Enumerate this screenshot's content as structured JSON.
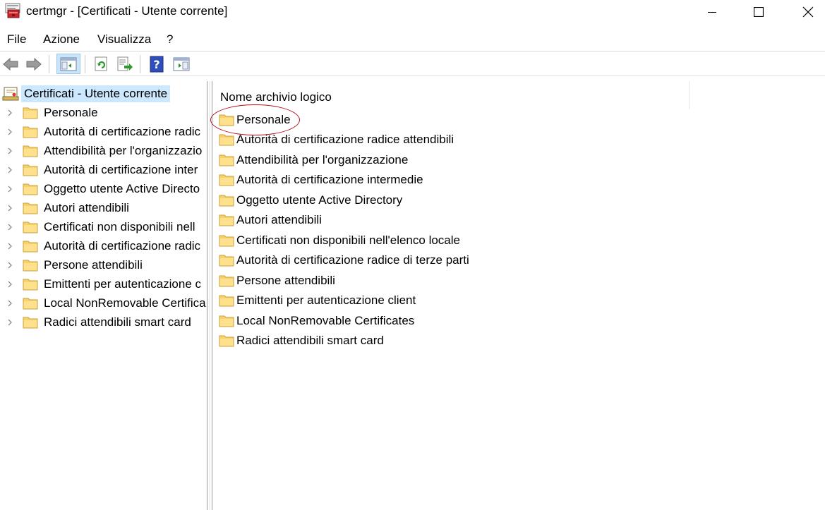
{
  "window": {
    "title": "certmgr - [Certificati - Utente corrente]"
  },
  "menu": {
    "items": [
      "File",
      "Azione",
      "Visualizza",
      "?"
    ]
  },
  "toolbar": {
    "buttons": [
      "back-arrow-icon",
      "forward-arrow-icon",
      "show-hide-console-tree-icon",
      "refresh-icon",
      "export-list-icon",
      "help-icon",
      "show-hide-action-pane-icon"
    ]
  },
  "tree": {
    "root_label": "Certificati - Utente corrente",
    "items": [
      "Personale",
      "Autorità di certificazione radic",
      "Attendibilità per l'organizzazio",
      "Autorità di certificazione inter",
      "Oggetto utente Active Directo",
      "Autori attendibili",
      "Certificati non disponibili nell",
      "Autorità di certificazione radic",
      "Persone attendibili",
      "Emittenti per autenticazione c",
      "Local NonRemovable Certifica",
      "Radici attendibili smart card"
    ]
  },
  "list": {
    "column_header": "Nome archivio logico",
    "items": [
      "Personale",
      "Autorità di certificazione radice attendibili",
      "Attendibilità per l'organizzazione",
      "Autorità di certificazione intermedie",
      "Oggetto utente Active Directory",
      "Autori attendibili",
      "Certificati non disponibili nell'elenco locale",
      "Autorità di certificazione radice di terze parti",
      "Persone attendibili",
      "Emittenti per autenticazione client",
      "Local NonRemovable Certificates",
      "Radici attendibili smart card"
    ]
  },
  "colors": {
    "selection": "#cce8ff",
    "annotation_ellipse": "#b5121b",
    "folder_fill": "#ffd66b"
  }
}
